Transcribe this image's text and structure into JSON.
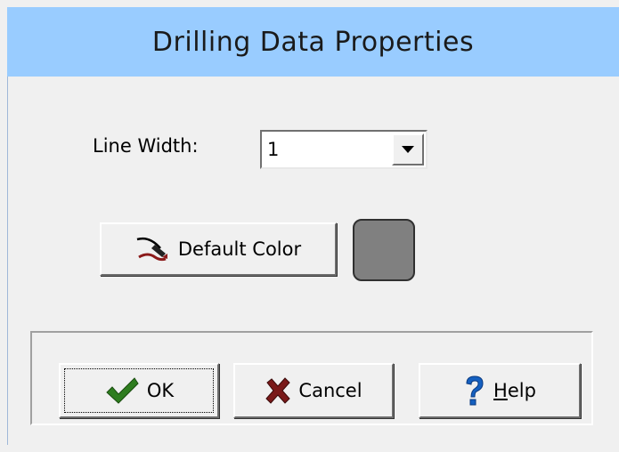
{
  "window": {
    "title": "Drilling Data Properties"
  },
  "line_width": {
    "label": "Line Width:",
    "value": "1",
    "dropdown_icon": "chevron-down-icon"
  },
  "color": {
    "button_label": "Default Color",
    "button_icon": "paint-pen-icon",
    "swatch_color": "#808080"
  },
  "buttons": {
    "ok": {
      "label": "OK",
      "icon": "checkmark-icon"
    },
    "cancel": {
      "label": "Cancel",
      "icon": "x-icon"
    },
    "help": {
      "label": "Help",
      "icon": "question-icon"
    }
  },
  "colors": {
    "title_bar": "#99ccff",
    "background": "#f0f0f0",
    "ok_check": "#2e7d1f",
    "cancel_x": "#7a1a1a",
    "help_question": "#1560c0"
  }
}
